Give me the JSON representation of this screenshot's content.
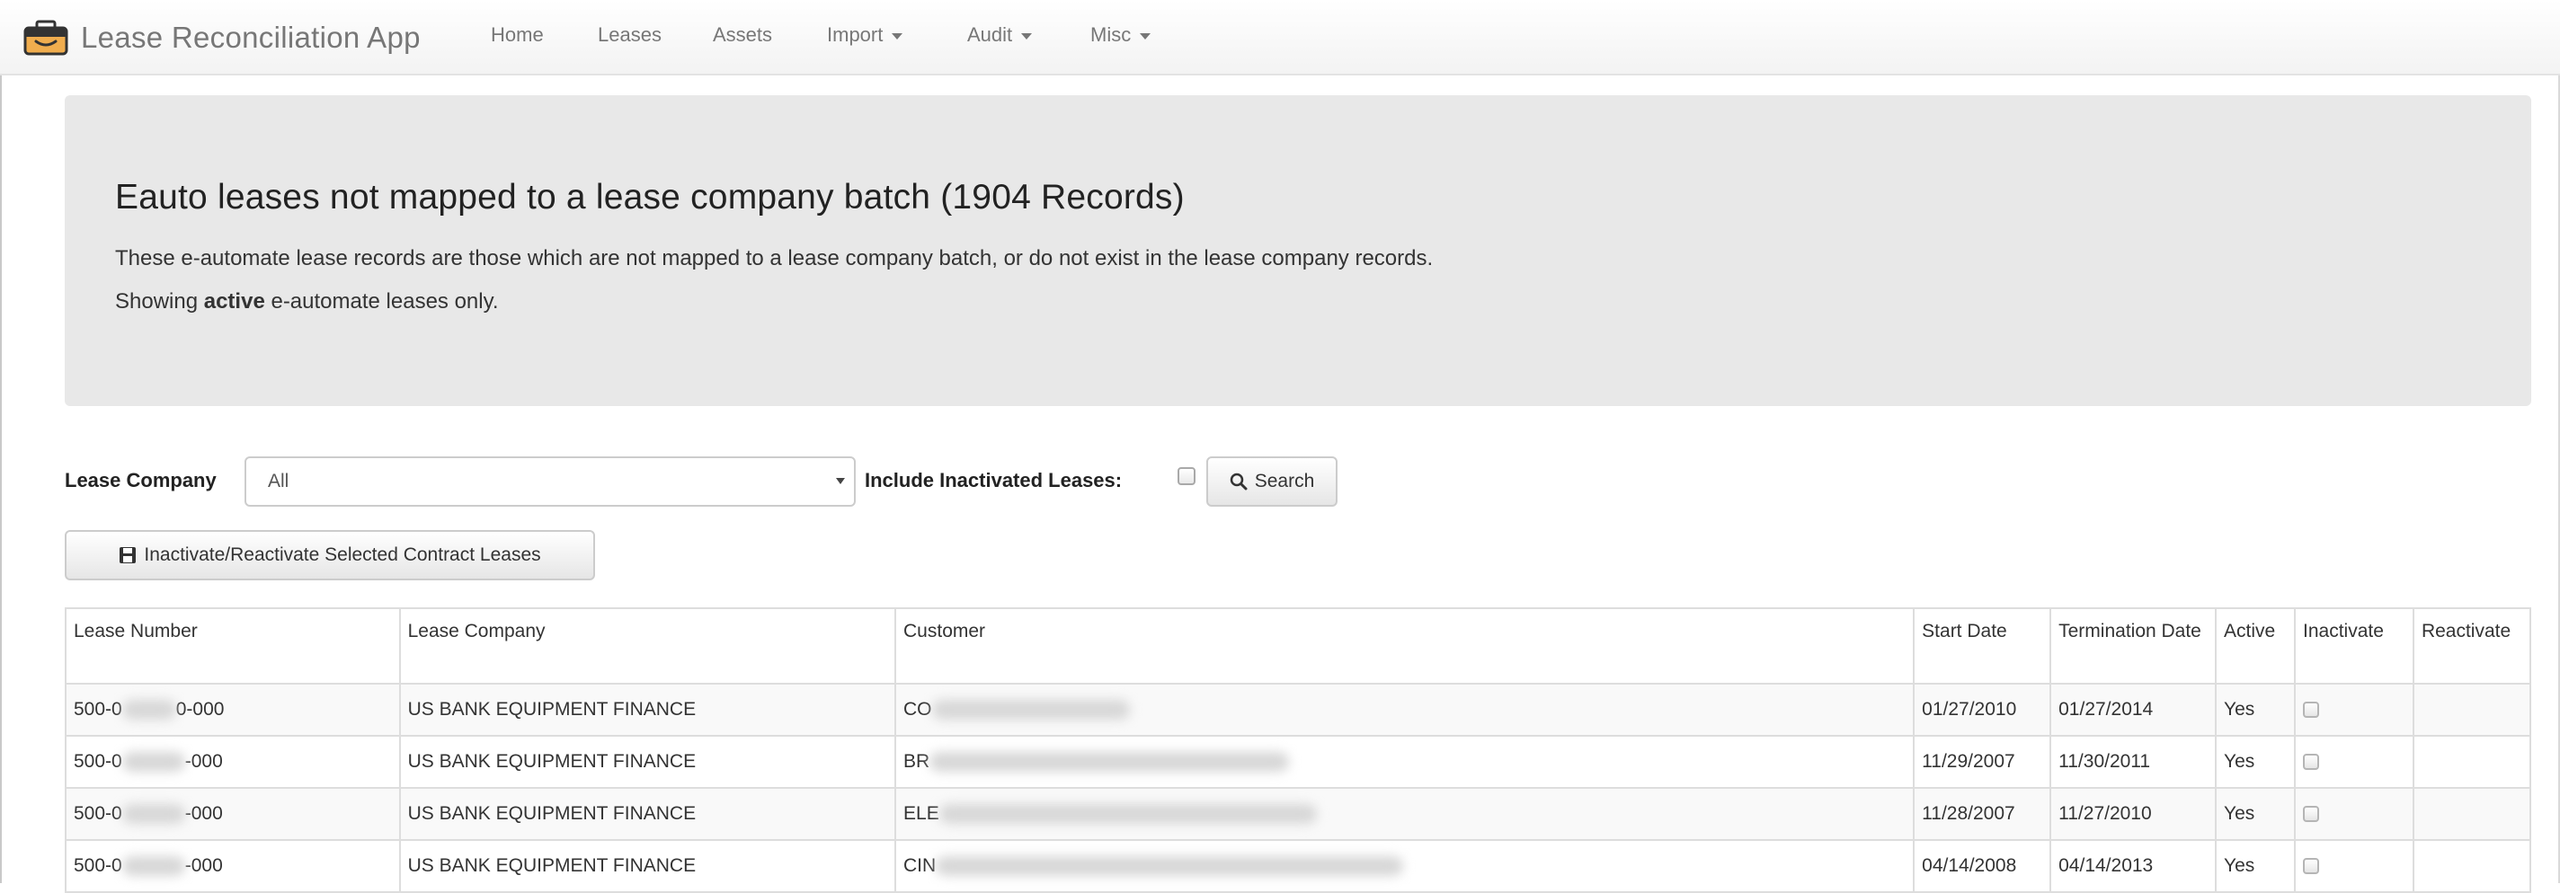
{
  "app": {
    "title": "Lease Reconciliation App",
    "accent_color": "#f0ad4e"
  },
  "nav": {
    "items": [
      {
        "label": "Home",
        "dropdown": false
      },
      {
        "label": "Leases",
        "dropdown": false
      },
      {
        "label": "Assets",
        "dropdown": false
      },
      {
        "label": "Import",
        "dropdown": true
      },
      {
        "label": "Audit",
        "dropdown": true
      },
      {
        "label": "Misc",
        "dropdown": true
      }
    ]
  },
  "jumbotron": {
    "heading": "Eauto leases not mapped to a lease company batch (1904 Records)",
    "description": "These e-automate lease records are those which are not mapped to a lease company batch, or do not exist in the lease company records.",
    "showing_prefix": "Showing ",
    "showing_bold": "active",
    "showing_suffix": " e-automate leases only."
  },
  "filters": {
    "lease_company_label": "Lease Company",
    "lease_company_value": "All",
    "include_inactivated_label": "Include Inactivated Leases:",
    "include_inactivated_checked": false,
    "search_button": "Search",
    "bulk_button": "Inactivate/Reactivate Selected Contract Leases"
  },
  "table": {
    "headers": {
      "lease_number": "Lease Number",
      "lease_company": "Lease Company",
      "customer": "Customer",
      "start_date": "Start Date",
      "termination_date": "Termination Date",
      "active": "Active",
      "inactivate": "Inactivate",
      "reactivate": "Reactivate"
    },
    "rows": [
      {
        "lease_prefix": "500-0",
        "lease_suffix": "0-000",
        "lease_company": "US BANK EQUIPMENT FINANCE",
        "customer_prefix": "CO",
        "start_date": "01/27/2010",
        "termination_date": "01/27/2014",
        "active": "Yes"
      },
      {
        "lease_prefix": "500-0",
        "lease_suffix": "-000",
        "lease_company": "US BANK EQUIPMENT FINANCE",
        "customer_prefix": "BR",
        "start_date": "11/29/2007",
        "termination_date": "11/30/2011",
        "active": "Yes"
      },
      {
        "lease_prefix": "500-0",
        "lease_suffix": "-000",
        "lease_company": "US BANK EQUIPMENT FINANCE",
        "customer_prefix": "ELE",
        "start_date": "11/28/2007",
        "termination_date": "11/27/2010",
        "active": "Yes"
      },
      {
        "lease_prefix": "500-0",
        "lease_suffix": "-000",
        "lease_company": "US BANK EQUIPMENT FINANCE",
        "customer_prefix": "CIN",
        "start_date": "04/14/2008",
        "termination_date": "04/14/2013",
        "active": "Yes"
      }
    ]
  }
}
